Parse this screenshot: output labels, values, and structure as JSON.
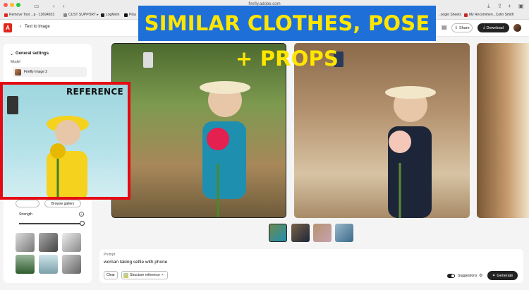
{
  "browser": {
    "url": "firefly.adobe.com",
    "bookmarks": [
      "Remove Tool ...p - 13694923",
      "CUST SUPPORT ▸",
      "LogMeIn",
      "Pika",
      "..oogle Sheets",
      "My Recommen...Colin Smith"
    ]
  },
  "header": {
    "back_label": "Text to image",
    "share_label": "Share",
    "download_label": "Download"
  },
  "banner": {
    "text": "SIMILAR CLOTHES, POSE + PROPS",
    "bg_color": "#1f6fd9",
    "text_color": "#ffe600"
  },
  "sidebar": {
    "section_title": "General settings",
    "model_label": "Model",
    "model_value": "Firefly Image 2",
    "browse_gallery_label": "Browse gallery",
    "strength_label": "Strength",
    "strength_level": 1.0
  },
  "reference": {
    "label": "REFERENCE",
    "border_color": "#e50914"
  },
  "prompt": {
    "label": "Prompt",
    "text": "woman taking selfie with phone",
    "clear_label": "Clear",
    "chip_label": "Structure reference",
    "suggestions_label": "Suggestions",
    "generate_label": "Generate"
  }
}
